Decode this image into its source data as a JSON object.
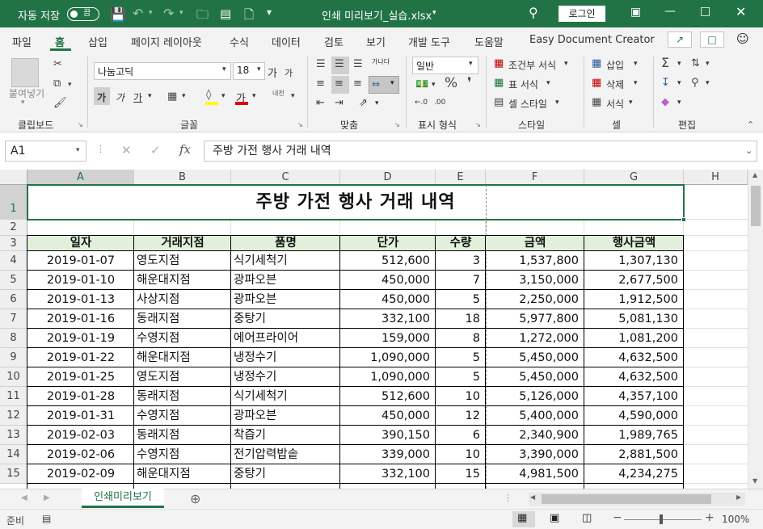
{
  "titlebar": {
    "autosave_label": "자동 저장",
    "toggle_state": "끔",
    "filename": "인쇄 미리보기_실습.xlsx",
    "login_label": "로그인"
  },
  "tabs": [
    "파일",
    "홈",
    "삽입",
    "페이지 레이아웃",
    "수식",
    "데이터",
    "검토",
    "보기",
    "개발 도구",
    "도움말",
    "Easy Document Creator"
  ],
  "ribbon": {
    "clipboard": {
      "group": "클립보드",
      "paste": "붙여넣기"
    },
    "font": {
      "group": "글꼴",
      "name": "나눔고딕",
      "size": "18",
      "bold": "가",
      "italic": "가",
      "underline": "가",
      "fontcolor": "가",
      "grow": "가",
      "shrink": "가",
      "phonetic": "내천"
    },
    "align": {
      "group": "맞춤",
      "wrap": "가나다"
    },
    "number": {
      "group": "표시 형식",
      "format": "일반"
    },
    "styles": {
      "group": "스타일",
      "conditional": "조건부 서식",
      "table": "표 서식",
      "cell": "셀 스타일"
    },
    "cells": {
      "group": "셀",
      "insert": "삽입",
      "delete": "삭제",
      "format": "서식"
    },
    "edit": {
      "group": "편집"
    }
  },
  "formula": {
    "namebox": "A1",
    "content": "주방 가전 행사 거래 내역"
  },
  "columns": [
    "A",
    "B",
    "C",
    "D",
    "E",
    "F",
    "G",
    "H"
  ],
  "rows": [
    "1",
    "2",
    "3",
    "4",
    "5",
    "6",
    "7",
    "8",
    "9",
    "10",
    "11",
    "12",
    "13",
    "14",
    "15"
  ],
  "sheet": {
    "title": "주방 가전 행사 거래 내역",
    "headers": [
      "일자",
      "거래지점",
      "품명",
      "단가",
      "수량",
      "금액",
      "행사금액"
    ],
    "data": [
      [
        "2019-01-07",
        "영도지점",
        "식기세척기",
        "512,600",
        "3",
        "1,537,800",
        "1,307,130"
      ],
      [
        "2019-01-10",
        "해운대지점",
        "광파오븐",
        "450,000",
        "7",
        "3,150,000",
        "2,677,500"
      ],
      [
        "2019-01-13",
        "사상지점",
        "광파오븐",
        "450,000",
        "5",
        "2,250,000",
        "1,912,500"
      ],
      [
        "2019-01-16",
        "동래지점",
        "중탕기",
        "332,100",
        "18",
        "5,977,800",
        "5,081,130"
      ],
      [
        "2019-01-19",
        "수영지점",
        "에어프라이어",
        "159,000",
        "8",
        "1,272,000",
        "1,081,200"
      ],
      [
        "2019-01-22",
        "해운대지점",
        "냉정수기",
        "1,090,000",
        "5",
        "5,450,000",
        "4,632,500"
      ],
      [
        "2019-01-25",
        "영도지점",
        "냉정수기",
        "1,090,000",
        "5",
        "5,450,000",
        "4,632,500"
      ],
      [
        "2019-01-28",
        "동래지점",
        "식기세척기",
        "512,600",
        "10",
        "5,126,000",
        "4,357,100"
      ],
      [
        "2019-01-31",
        "수영지점",
        "광파오븐",
        "450,000",
        "12",
        "5,400,000",
        "4,590,000"
      ],
      [
        "2019-02-03",
        "동래지점",
        "착즙기",
        "390,150",
        "6",
        "2,340,900",
        "1,989,765"
      ],
      [
        "2019-02-06",
        "수영지점",
        "전기압력밥솥",
        "339,000",
        "10",
        "3,390,000",
        "2,881,500"
      ],
      [
        "2019-02-09",
        "해운대지점",
        "중탕기",
        "332,100",
        "15",
        "4,981,500",
        "4,234,275"
      ]
    ]
  },
  "sheet_tab": "인쇄미리보기",
  "status": {
    "mode": "준비",
    "zoom": "100%"
  },
  "colors": {
    "brand": "#217346",
    "header_fill": "#e2efda"
  }
}
